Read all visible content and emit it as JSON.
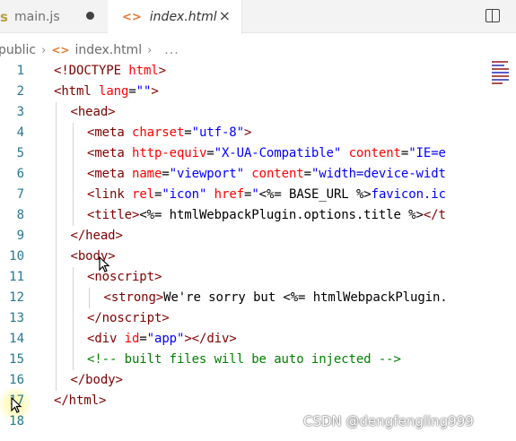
{
  "tabs": [
    {
      "label": "main.js",
      "icon": "js-file-icon",
      "glyph": "s",
      "state": "modified"
    },
    {
      "label": "index.html",
      "icon": "html-file-icon",
      "glyph": "<>",
      "state": "active"
    }
  ],
  "tab_actions": {
    "split_editor": "split-editor-icon",
    "close": "×"
  },
  "breadcrumb": {
    "folder": "public",
    "sep": "›",
    "file": "index.html",
    "file_glyph": "<>",
    "more": "..."
  },
  "editor": {
    "lines": [
      {
        "n": "1",
        "indent": 0,
        "tokens": [
          [
            "t",
            "<!DOCTYPE "
          ],
          [
            "a",
            "html"
          ],
          [
            "t",
            ">"
          ]
        ]
      },
      {
        "n": "2",
        "indent": 0,
        "tokens": [
          [
            "t",
            "<html "
          ],
          [
            "a",
            "lang"
          ],
          [
            "x",
            "="
          ],
          [
            "v",
            "\"\""
          ],
          [
            "t",
            ">"
          ]
        ]
      },
      {
        "n": "3",
        "indent": 1,
        "tokens": [
          [
            "t",
            "<head>"
          ]
        ]
      },
      {
        "n": "4",
        "indent": 2,
        "tokens": [
          [
            "t",
            "<meta "
          ],
          [
            "a",
            "charset"
          ],
          [
            "x",
            "="
          ],
          [
            "v",
            "\"utf-8\""
          ],
          [
            "t",
            ">"
          ]
        ]
      },
      {
        "n": "5",
        "indent": 2,
        "tokens": [
          [
            "t",
            "<meta "
          ],
          [
            "a",
            "http-equiv"
          ],
          [
            "x",
            "="
          ],
          [
            "v",
            "\"X-UA-Compatible\""
          ],
          [
            "x",
            " "
          ],
          [
            "a",
            "content"
          ],
          [
            "x",
            "="
          ],
          [
            "v",
            "\"IE=e"
          ]
        ]
      },
      {
        "n": "6",
        "indent": 2,
        "tokens": [
          [
            "t",
            "<meta "
          ],
          [
            "a",
            "name"
          ],
          [
            "x",
            "="
          ],
          [
            "v",
            "\"viewport\""
          ],
          [
            "x",
            " "
          ],
          [
            "a",
            "content"
          ],
          [
            "x",
            "="
          ],
          [
            "v",
            "\"width=device-widt"
          ]
        ]
      },
      {
        "n": "7",
        "indent": 2,
        "tokens": [
          [
            "t",
            "<link "
          ],
          [
            "a",
            "rel"
          ],
          [
            "x",
            "="
          ],
          [
            "v",
            "\"icon\""
          ],
          [
            "x",
            " "
          ],
          [
            "a",
            "href"
          ],
          [
            "x",
            "="
          ],
          [
            "v",
            "\""
          ],
          [
            "x",
            "<%= BASE_URL %>"
          ],
          [
            "v",
            "favicon.ic"
          ]
        ]
      },
      {
        "n": "8",
        "indent": 2,
        "tokens": [
          [
            "t",
            "<title>"
          ],
          [
            "x",
            "<%= htmlWebpackPlugin.options.title %>"
          ],
          [
            "t",
            "</t"
          ]
        ]
      },
      {
        "n": "9",
        "indent": 1,
        "tokens": [
          [
            "t",
            "</head>"
          ]
        ]
      },
      {
        "n": "10",
        "indent": 1,
        "tokens": [
          [
            "t",
            "<body>"
          ]
        ]
      },
      {
        "n": "11",
        "indent": 2,
        "tokens": [
          [
            "t",
            "<noscript>"
          ]
        ]
      },
      {
        "n": "12",
        "indent": 3,
        "tokens": [
          [
            "t",
            "<strong>"
          ],
          [
            "x",
            "We're sorry but <%= htmlWebpackPlugin."
          ]
        ]
      },
      {
        "n": "13",
        "indent": 2,
        "tokens": [
          [
            "t",
            "</noscript>"
          ]
        ]
      },
      {
        "n": "14",
        "indent": 2,
        "tokens": [
          [
            "t",
            "<div "
          ],
          [
            "a",
            "id"
          ],
          [
            "x",
            "="
          ],
          [
            "v",
            "\"app\""
          ],
          [
            "t",
            "></div>"
          ]
        ]
      },
      {
        "n": "15",
        "indent": 2,
        "tokens": [
          [
            "c",
            "<!-- built files will be auto injected -->"
          ]
        ]
      },
      {
        "n": "16",
        "indent": 1,
        "tokens": [
          [
            "t",
            "</body>"
          ]
        ]
      },
      {
        "n": "17",
        "indent": 0,
        "tokens": [
          [
            "t",
            "</html>"
          ]
        ]
      },
      {
        "n": "18",
        "indent": 0,
        "tokens": []
      }
    ]
  },
  "colors": {
    "tag": "#800000",
    "attr": "#ff0000",
    "value": "#0000ff",
    "comment": "#008000",
    "line_number": "#237893"
  },
  "watermark": "CSDN @dengfengling999"
}
